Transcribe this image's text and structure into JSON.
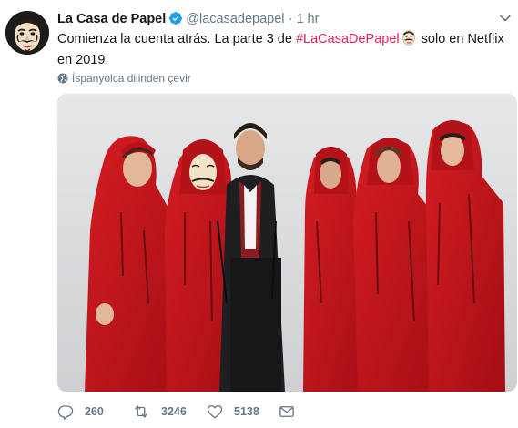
{
  "account": {
    "name": "La Casa de Papel",
    "handle": "@lacasadepapel",
    "separator": "·",
    "time": "1 hr"
  },
  "tweet": {
    "text_before": "Comienza la cuenta atrás. La parte 3 de ",
    "hashtag": "#LaCasaDePapel",
    "text_after": " solo en Netflix en 2019."
  },
  "translate": {
    "label": "İspanyolca dilinden çevir"
  },
  "actions": {
    "replies": "260",
    "retweets": "3246",
    "likes": "5138"
  },
  "colors": {
    "hashtag": "#e0245e",
    "verified": "#1da1f2",
    "jumpsuit": "#c8161d",
    "muted": "#657786"
  },
  "icons": [
    "mask-avatar",
    "verified-badge-icon",
    "chevron-down-icon",
    "globe-icon",
    "reply-icon",
    "retweet-icon",
    "like-icon",
    "dm-icon"
  ]
}
